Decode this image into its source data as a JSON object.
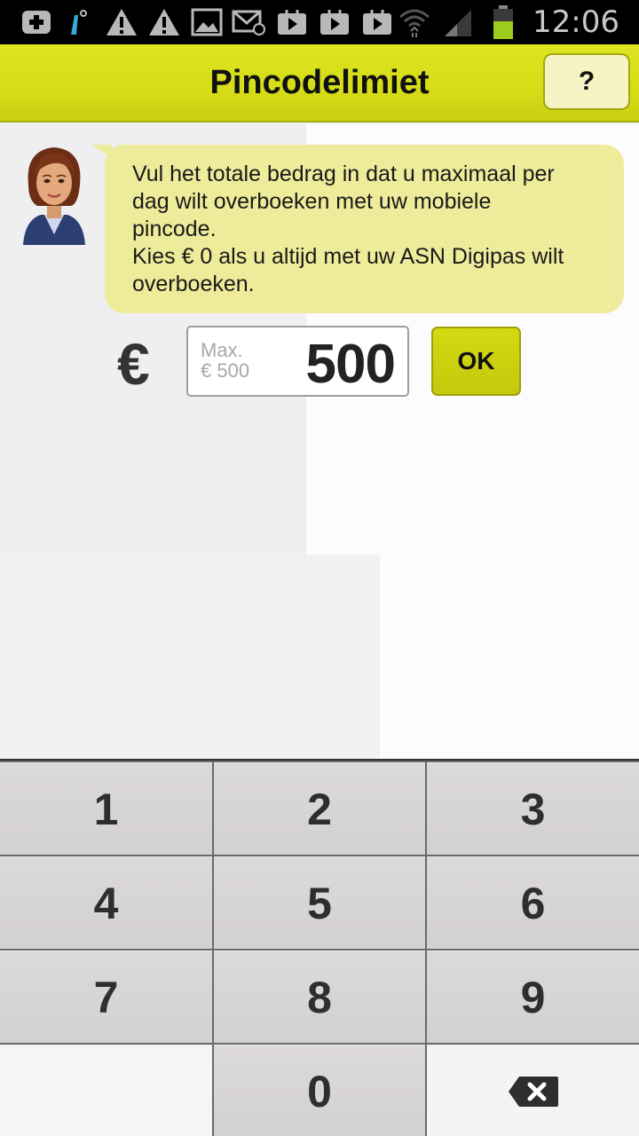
{
  "status_bar": {
    "time": "12:06",
    "icons_left": [
      "plus-box-icon",
      "signal-up-icon",
      "warning-icon",
      "warning-icon",
      "image-icon",
      "mail-icon",
      "play-store-icon",
      "play-store-icon",
      "play-store-icon"
    ],
    "icons_right": [
      "wifi-icon",
      "cell-signal-icon",
      "battery-icon"
    ],
    "battery_color": "#9ccc1c"
  },
  "header": {
    "title": "Pincodelimiet",
    "help_label": "?",
    "color": "#d6dc16"
  },
  "message": {
    "lines": [
      "Vul het totale bedrag in dat u maximaal per",
      "dag wilt overboeken met uw mobiele",
      "pincode.",
      "Kies € 0 als u altijd met uw ASN Digipas wilt",
      "overboeken."
    ]
  },
  "amount": {
    "currency": "€",
    "hint_line1": "Max.",
    "hint_line2": "€ 500",
    "value": "500",
    "ok_label": "OK"
  },
  "keypad": {
    "keys": [
      "1",
      "2",
      "3",
      "4",
      "5",
      "6",
      "7",
      "8",
      "9",
      "",
      "0",
      "backspace"
    ]
  }
}
